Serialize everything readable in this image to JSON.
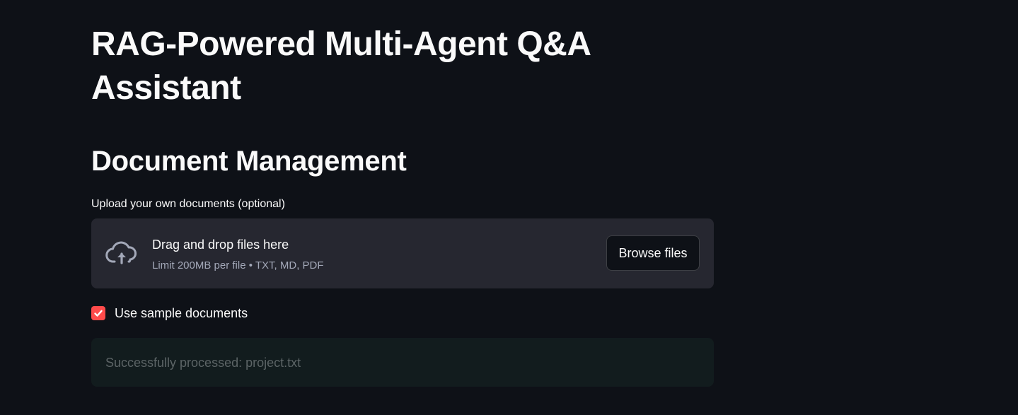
{
  "page": {
    "title": "RAG-Powered Multi-Agent Q&A Assistant"
  },
  "document_management": {
    "heading": "Document Management",
    "uploader": {
      "label": "Upload your own documents (optional)",
      "drop_text": "Drag and drop files here",
      "limit_text": "Limit 200MB per file • TXT, MD, PDF",
      "browse_label": "Browse files",
      "icon": "cloud-upload-icon"
    },
    "sample_checkbox": {
      "label": "Use sample documents",
      "checked": true,
      "icon": "checkmark-icon"
    },
    "status_message": "Successfully processed: project.txt"
  },
  "colors": {
    "background": "#0e1117",
    "dropzone": "#262730",
    "accent": "#ff4b4b",
    "success_bg": "#121c1e"
  }
}
